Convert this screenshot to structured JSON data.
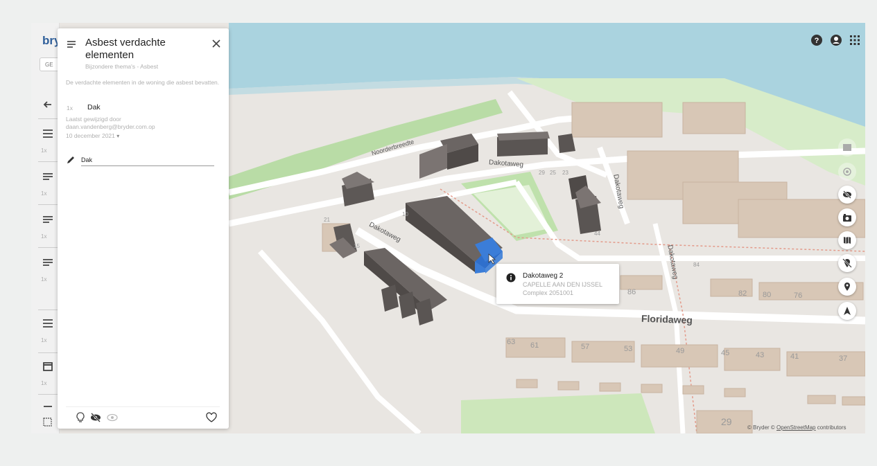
{
  "app": {
    "logo_text": "bry",
    "nav_chip": "GE"
  },
  "nav": {
    "counts": [
      "1x",
      "1x",
      "1x",
      "1x",
      "1x",
      "1x"
    ]
  },
  "panel": {
    "title": "Asbest verdachte elementen",
    "subtitle": "Bijzondere thema's - Asbest",
    "description": "De verdachte elementen in de woning die asbest bevatten.",
    "count": "1x",
    "value": "Dak",
    "last_modified_label": "Laatst gewijzigd door",
    "last_modified_by": "daan.vandenberg@bryder.com.op",
    "date": "10 december 2021",
    "edit_value": "Dak"
  },
  "popup": {
    "address": "Dakotaweg 2",
    "city": "CAPELLE AAN DEN IJSSEL",
    "complex": "Complex 2051001"
  },
  "map": {
    "streets": [
      "Dakotaweg",
      "Dakotaweg",
      "Dakotaweg",
      "Dakotaweg",
      "Floridaweg",
      "Noorderbreedte"
    ],
    "house_numbers": [
      "63",
      "61",
      "57",
      "53",
      "49",
      "45",
      "43",
      "41",
      "37",
      "29",
      "82",
      "80",
      "76",
      "86",
      "84",
      "44",
      "21",
      "15",
      "10",
      "29",
      "25",
      "23"
    ]
  },
  "attribution": {
    "prefix": "© Bryder © ",
    "link": "OpenStreetMap",
    "suffix": " contributors"
  },
  "colors": {
    "selected_building": "#3b7dd8",
    "water": "#aad3df",
    "park": "#c8e6b4",
    "building": "#5f5a58"
  },
  "icons": [
    "help-icon",
    "account-icon",
    "apps-icon",
    "close-icon",
    "edit-icon",
    "lightbulb-icon",
    "eye-off-icon",
    "eye-icon",
    "heart-icon",
    "info-icon"
  ]
}
